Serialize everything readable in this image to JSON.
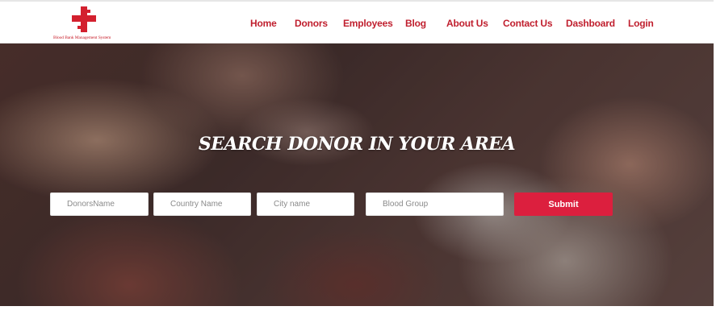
{
  "brand": {
    "logo_text": "Blood Bank Management System",
    "accent_color": "#dc1f3e"
  },
  "nav": {
    "items": [
      {
        "label": "Home"
      },
      {
        "label": "Donors"
      },
      {
        "label": "Employees"
      },
      {
        "label": "Blog"
      },
      {
        "label": "About Us"
      },
      {
        "label": "Contact Us"
      },
      {
        "label": "Dashboard"
      },
      {
        "label": "Login"
      }
    ]
  },
  "hero": {
    "title": "SEARCH DONOR IN YOUR AREA",
    "fields": [
      {
        "placeholder": "DonorsName",
        "value": ""
      },
      {
        "placeholder": "Country Name",
        "value": ""
      },
      {
        "placeholder": "City name",
        "value": ""
      },
      {
        "placeholder": "Blood Group",
        "value": ""
      }
    ],
    "submit_label": "Submit"
  }
}
